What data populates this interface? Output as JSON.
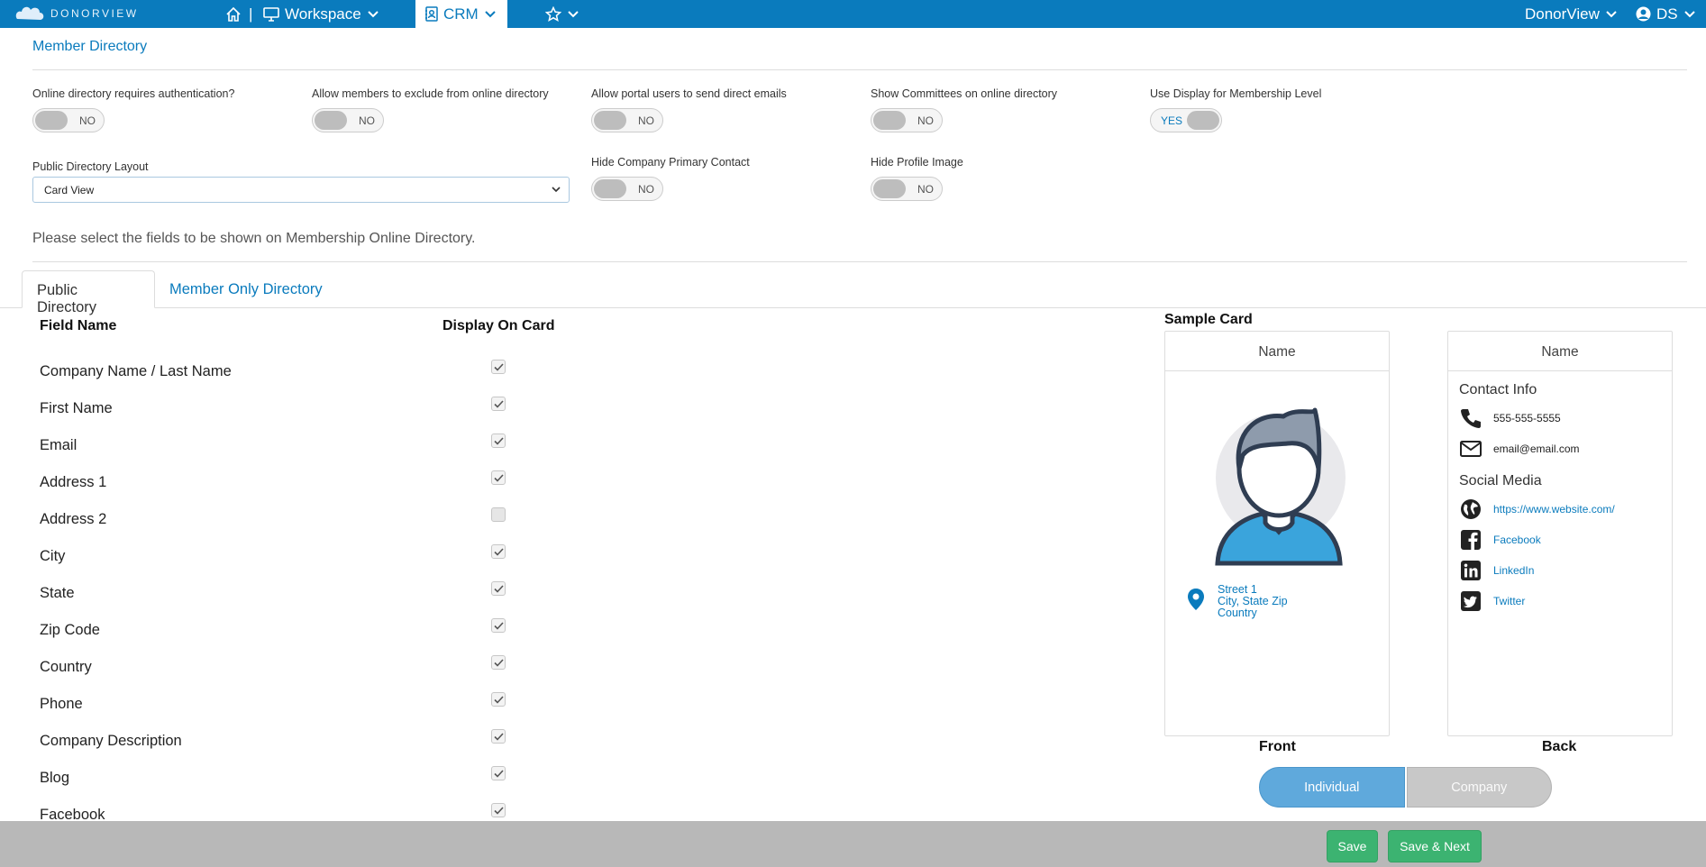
{
  "nav": {
    "logo_text": "DONORVIEW",
    "workspace": "Workspace",
    "crm": "CRM",
    "account": "DonorView",
    "user_initials": "DS",
    "separator": "|"
  },
  "section_title": "Member Directory",
  "settings": {
    "auth": {
      "label": "Online directory requires authentication?",
      "value": "NO"
    },
    "exclude": {
      "label": "Allow members to exclude from online directory",
      "value": "NO"
    },
    "emails": {
      "label": "Allow portal users to send direct emails",
      "value": "NO"
    },
    "committees": {
      "label": "Show Committees on online directory",
      "value": "NO"
    },
    "display_level": {
      "label": "Use Display for Membership Level",
      "value": "YES"
    },
    "hide_primary": {
      "label": "Hide Company Primary Contact",
      "value": "NO"
    },
    "hide_image": {
      "label": "Hide Profile Image",
      "value": "NO"
    }
  },
  "layout_select": {
    "label": "Public Directory Layout",
    "value": "Card View"
  },
  "instruction": "Please select the fields to be shown on Membership Online Directory.",
  "tabs": [
    {
      "label": "Public Directory",
      "active": true
    },
    {
      "label": "Member Only Directory",
      "active": false
    }
  ],
  "table": {
    "col_field": "Field Name",
    "col_display": "Display On Card",
    "rows": [
      {
        "name": "Company Name / Last Name",
        "checked": true
      },
      {
        "name": "First Name",
        "checked": true
      },
      {
        "name": "Email",
        "checked": true
      },
      {
        "name": "Address 1",
        "checked": true
      },
      {
        "name": "Address 2",
        "checked": false
      },
      {
        "name": "City",
        "checked": true
      },
      {
        "name": "State",
        "checked": true
      },
      {
        "name": "Zip Code",
        "checked": true
      },
      {
        "name": "Country",
        "checked": true
      },
      {
        "name": "Phone",
        "checked": true
      },
      {
        "name": "Company Description",
        "checked": true
      },
      {
        "name": "Blog",
        "checked": true
      },
      {
        "name": "Facebook",
        "checked": true
      }
    ]
  },
  "sample": {
    "title": "Sample Card",
    "front": {
      "name": "Name",
      "address": [
        "Street 1",
        "City, State Zip",
        "Country"
      ],
      "label": "Front"
    },
    "back": {
      "name": "Name",
      "contact_title": "Contact Info",
      "phone": "555-555-5555",
      "email": "email@email.com",
      "social_title": "Social Media",
      "website": "https://www.website.com/",
      "facebook": "Facebook",
      "linkedin": "LinkedIn",
      "twitter": "Twitter",
      "label": "Back"
    },
    "toggle": {
      "individual": "Individual",
      "company": "Company",
      "selected": "Individual"
    }
  },
  "footer": {
    "save": "Save",
    "save_next": "Save & Next"
  },
  "colors": {
    "brand": "#0a7bbd",
    "save": "#3cb371",
    "toggle_active": "#5fa9dc"
  }
}
